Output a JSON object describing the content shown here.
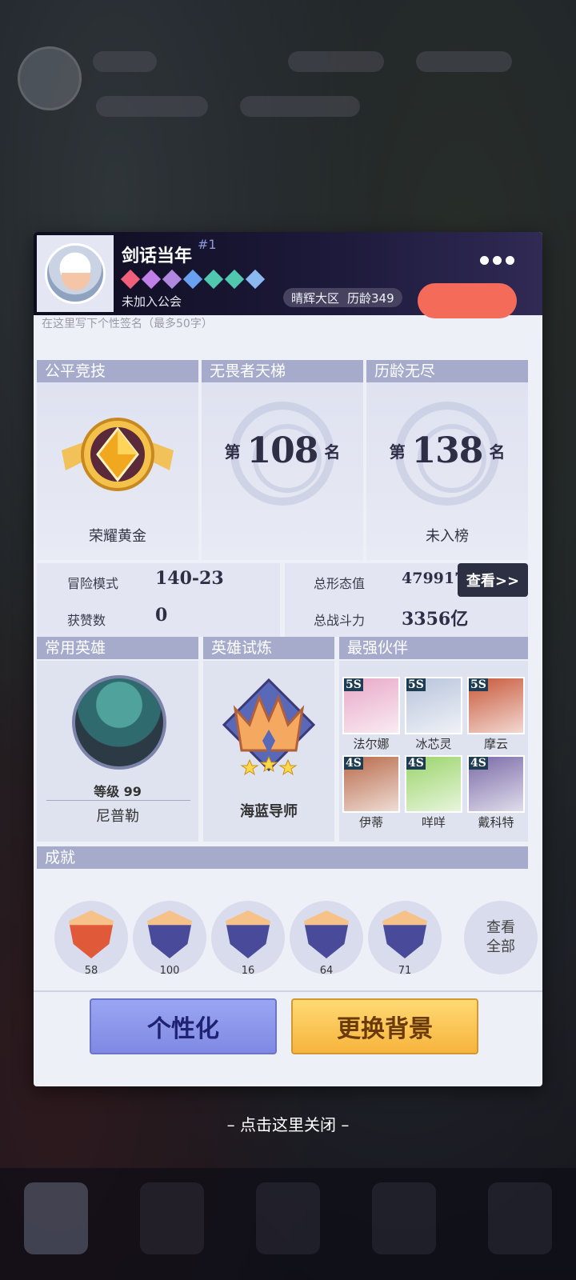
{
  "header": {
    "player_name": "剑话当年",
    "player_rank": "#1",
    "guild": "未加入公会",
    "region": "晴辉大区",
    "history_age": "历龄349",
    "signature_placeholder": "在这里写下个性签名（最多50字）",
    "gem_colors": [
      "#f0607a",
      "#c080e8",
      "#b088e0",
      "#6aa0f0",
      "#50c8b0",
      "#50c8b0",
      "#8ab8f0"
    ]
  },
  "ranks": [
    {
      "title": "公平竞技",
      "label": "荣耀黄金"
    },
    {
      "title": "无畏者天梯",
      "prefix": "第",
      "number": "108",
      "suffix": "名"
    },
    {
      "title": "历龄无尽",
      "prefix": "第",
      "number": "138",
      "suffix": "名",
      "label": "未入榜"
    }
  ],
  "stats": {
    "adventure_label": "冒险模式",
    "adventure_value": "140-23",
    "likes_label": "获赞数",
    "likes_value": "0",
    "form_label": "总形态值",
    "form_value": "479917",
    "power_label": "总战斗力",
    "power_value": "3356亿",
    "view_button": "查看>>"
  },
  "common_hero": {
    "title": "常用英雄",
    "level": "等级 99",
    "name": "尼普勒"
  },
  "trial": {
    "title": "英雄试炼",
    "name": "海蓝导师"
  },
  "partners": {
    "title": "最强伙伴",
    "items": [
      {
        "tag": "5S",
        "name": "法尔娜",
        "color": "#e8a8c8"
      },
      {
        "tag": "5S",
        "name": "冰芯灵",
        "color": "#b8c4dc"
      },
      {
        "tag": "5S",
        "name": "摩云",
        "color": "#c8583a"
      },
      {
        "tag": "4S",
        "name": "伊蒂",
        "color": "#b86a4a"
      },
      {
        "tag": "4S",
        "name": "咩咩",
        "color": "#9ad46a"
      },
      {
        "tag": "4S",
        "name": "戴科特",
        "color": "#7a6aa8"
      }
    ]
  },
  "achievements": {
    "title": "成就",
    "items": [
      {
        "count": "58",
        "color": "#e05a3a"
      },
      {
        "count": "100",
        "color": "#4a4a9a"
      },
      {
        "count": "16",
        "color": "#4a4a9a"
      },
      {
        "count": "64",
        "color": "#4a4a9a"
      },
      {
        "count": "71",
        "color": "#4a4a9a"
      }
    ],
    "view_all": "查看\n全部"
  },
  "buttons": {
    "customize": "个性化",
    "change_background": "更换背景"
  },
  "close_hint": "– 点击这里关闭 –"
}
